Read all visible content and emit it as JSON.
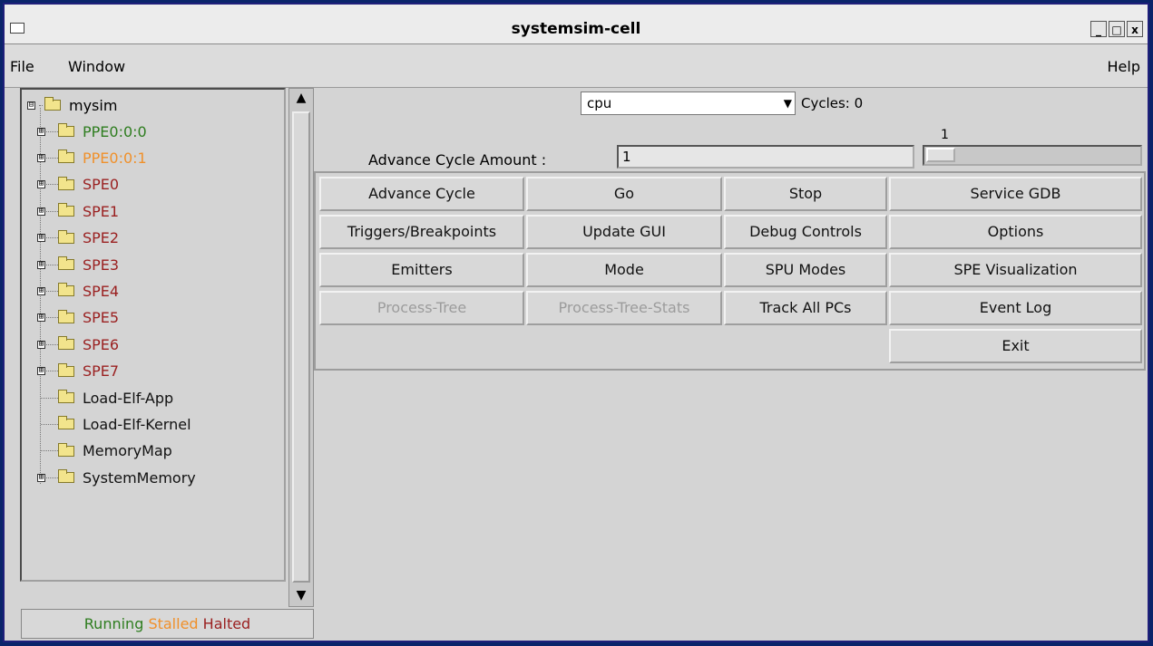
{
  "window": {
    "title": "systemsim-cell",
    "controls": {
      "minimize": "_",
      "maximize": "□",
      "close": "x"
    }
  },
  "menubar": {
    "file": "File",
    "window": "Window",
    "help": "Help"
  },
  "tree": {
    "root": {
      "label": "mysim",
      "expander": "⊟"
    },
    "items": [
      {
        "label": "PPE0:0:0",
        "color": "#2e7d1f",
        "expander": "⊞"
      },
      {
        "label": "PPE0:0:1",
        "color": "#f0902a",
        "expander": "⊞"
      },
      {
        "label": "SPE0",
        "color": "#9a1f1f",
        "expander": "⊞"
      },
      {
        "label": "SPE1",
        "color": "#9a1f1f",
        "expander": "⊞"
      },
      {
        "label": "SPE2",
        "color": "#9a1f1f",
        "expander": "⊞"
      },
      {
        "label": "SPE3",
        "color": "#9a1f1f",
        "expander": "⊞"
      },
      {
        "label": "SPE4",
        "color": "#9a1f1f",
        "expander": "⊞"
      },
      {
        "label": "SPE5",
        "color": "#9a1f1f",
        "expander": "⊞"
      },
      {
        "label": "SPE6",
        "color": "#9a1f1f",
        "expander": "⊞"
      },
      {
        "label": "SPE7",
        "color": "#9a1f1f",
        "expander": "⊞"
      },
      {
        "label": "Load-Elf-App",
        "color": "#111111",
        "expander": ""
      },
      {
        "label": "Load-Elf-Kernel",
        "color": "#111111",
        "expander": ""
      },
      {
        "label": "MemoryMap",
        "color": "#111111",
        "expander": ""
      },
      {
        "label": "SystemMemory",
        "color": "#111111",
        "expander": "⊞"
      }
    ]
  },
  "legend": {
    "running": "Running",
    "stalled": "Stalled",
    "halted": "Halted"
  },
  "controls": {
    "selector_value": "cpu",
    "cycles_label": "Cycles: 0",
    "slider_value": "1",
    "advance_amount_label": "Advance Cycle Amount :",
    "advance_amount_value": "1"
  },
  "buttons": {
    "advance_cycle": "Advance Cycle",
    "go": "Go",
    "stop": "Stop",
    "service_gdb": "Service GDB",
    "triggers_breakpoints": "Triggers/Breakpoints",
    "update_gui": "Update GUI",
    "debug_controls": "Debug Controls",
    "options": "Options",
    "emitters": "Emitters",
    "mode": "Mode",
    "spu_modes": "SPU Modes",
    "spe_visualization": "SPE Visualization",
    "process_tree": "Process-Tree",
    "process_tree_stats": "Process-Tree-Stats",
    "track_all_pcs": "Track All PCs",
    "event_log": "Event Log",
    "exit": "Exit"
  },
  "colors": {
    "running": "#2e7d1f",
    "stalled": "#f0902a",
    "halted": "#9a1f1f",
    "disabled_text": "#9c9c9c"
  }
}
